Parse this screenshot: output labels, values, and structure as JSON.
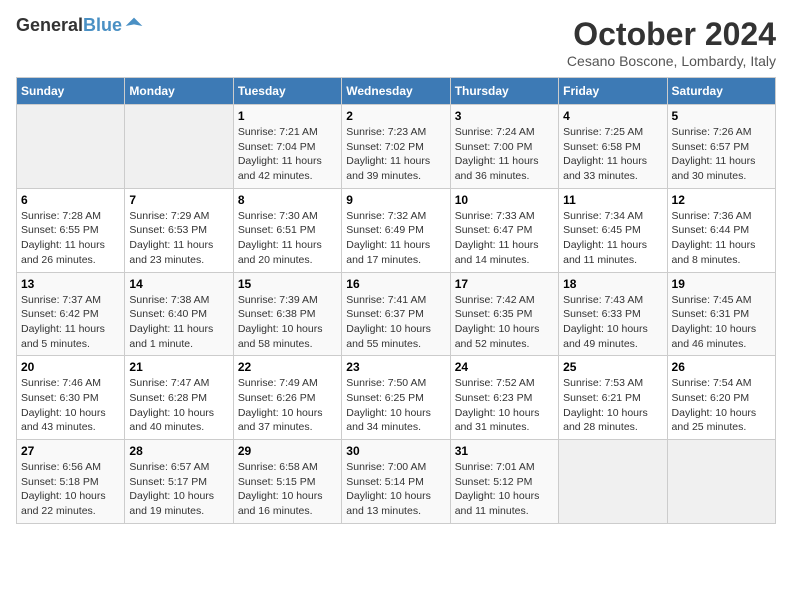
{
  "header": {
    "logo_line1": "General",
    "logo_line2": "Blue",
    "month_title": "October 2024",
    "location": "Cesano Boscone, Lombardy, Italy"
  },
  "days_of_week": [
    "Sunday",
    "Monday",
    "Tuesday",
    "Wednesday",
    "Thursday",
    "Friday",
    "Saturday"
  ],
  "weeks": [
    [
      {
        "num": "",
        "info": ""
      },
      {
        "num": "",
        "info": ""
      },
      {
        "num": "1",
        "info": "Sunrise: 7:21 AM\nSunset: 7:04 PM\nDaylight: 11 hours and 42 minutes."
      },
      {
        "num": "2",
        "info": "Sunrise: 7:23 AM\nSunset: 7:02 PM\nDaylight: 11 hours and 39 minutes."
      },
      {
        "num": "3",
        "info": "Sunrise: 7:24 AM\nSunset: 7:00 PM\nDaylight: 11 hours and 36 minutes."
      },
      {
        "num": "4",
        "info": "Sunrise: 7:25 AM\nSunset: 6:58 PM\nDaylight: 11 hours and 33 minutes."
      },
      {
        "num": "5",
        "info": "Sunrise: 7:26 AM\nSunset: 6:57 PM\nDaylight: 11 hours and 30 minutes."
      }
    ],
    [
      {
        "num": "6",
        "info": "Sunrise: 7:28 AM\nSunset: 6:55 PM\nDaylight: 11 hours and 26 minutes."
      },
      {
        "num": "7",
        "info": "Sunrise: 7:29 AM\nSunset: 6:53 PM\nDaylight: 11 hours and 23 minutes."
      },
      {
        "num": "8",
        "info": "Sunrise: 7:30 AM\nSunset: 6:51 PM\nDaylight: 11 hours and 20 minutes."
      },
      {
        "num": "9",
        "info": "Sunrise: 7:32 AM\nSunset: 6:49 PM\nDaylight: 11 hours and 17 minutes."
      },
      {
        "num": "10",
        "info": "Sunrise: 7:33 AM\nSunset: 6:47 PM\nDaylight: 11 hours and 14 minutes."
      },
      {
        "num": "11",
        "info": "Sunrise: 7:34 AM\nSunset: 6:45 PM\nDaylight: 11 hours and 11 minutes."
      },
      {
        "num": "12",
        "info": "Sunrise: 7:36 AM\nSunset: 6:44 PM\nDaylight: 11 hours and 8 minutes."
      }
    ],
    [
      {
        "num": "13",
        "info": "Sunrise: 7:37 AM\nSunset: 6:42 PM\nDaylight: 11 hours and 5 minutes."
      },
      {
        "num": "14",
        "info": "Sunrise: 7:38 AM\nSunset: 6:40 PM\nDaylight: 11 hours and 1 minute."
      },
      {
        "num": "15",
        "info": "Sunrise: 7:39 AM\nSunset: 6:38 PM\nDaylight: 10 hours and 58 minutes."
      },
      {
        "num": "16",
        "info": "Sunrise: 7:41 AM\nSunset: 6:37 PM\nDaylight: 10 hours and 55 minutes."
      },
      {
        "num": "17",
        "info": "Sunrise: 7:42 AM\nSunset: 6:35 PM\nDaylight: 10 hours and 52 minutes."
      },
      {
        "num": "18",
        "info": "Sunrise: 7:43 AM\nSunset: 6:33 PM\nDaylight: 10 hours and 49 minutes."
      },
      {
        "num": "19",
        "info": "Sunrise: 7:45 AM\nSunset: 6:31 PM\nDaylight: 10 hours and 46 minutes."
      }
    ],
    [
      {
        "num": "20",
        "info": "Sunrise: 7:46 AM\nSunset: 6:30 PM\nDaylight: 10 hours and 43 minutes."
      },
      {
        "num": "21",
        "info": "Sunrise: 7:47 AM\nSunset: 6:28 PM\nDaylight: 10 hours and 40 minutes."
      },
      {
        "num": "22",
        "info": "Sunrise: 7:49 AM\nSunset: 6:26 PM\nDaylight: 10 hours and 37 minutes."
      },
      {
        "num": "23",
        "info": "Sunrise: 7:50 AM\nSunset: 6:25 PM\nDaylight: 10 hours and 34 minutes."
      },
      {
        "num": "24",
        "info": "Sunrise: 7:52 AM\nSunset: 6:23 PM\nDaylight: 10 hours and 31 minutes."
      },
      {
        "num": "25",
        "info": "Sunrise: 7:53 AM\nSunset: 6:21 PM\nDaylight: 10 hours and 28 minutes."
      },
      {
        "num": "26",
        "info": "Sunrise: 7:54 AM\nSunset: 6:20 PM\nDaylight: 10 hours and 25 minutes."
      }
    ],
    [
      {
        "num": "27",
        "info": "Sunrise: 6:56 AM\nSunset: 5:18 PM\nDaylight: 10 hours and 22 minutes."
      },
      {
        "num": "28",
        "info": "Sunrise: 6:57 AM\nSunset: 5:17 PM\nDaylight: 10 hours and 19 minutes."
      },
      {
        "num": "29",
        "info": "Sunrise: 6:58 AM\nSunset: 5:15 PM\nDaylight: 10 hours and 16 minutes."
      },
      {
        "num": "30",
        "info": "Sunrise: 7:00 AM\nSunset: 5:14 PM\nDaylight: 10 hours and 13 minutes."
      },
      {
        "num": "31",
        "info": "Sunrise: 7:01 AM\nSunset: 5:12 PM\nDaylight: 10 hours and 11 minutes."
      },
      {
        "num": "",
        "info": ""
      },
      {
        "num": "",
        "info": ""
      }
    ]
  ]
}
